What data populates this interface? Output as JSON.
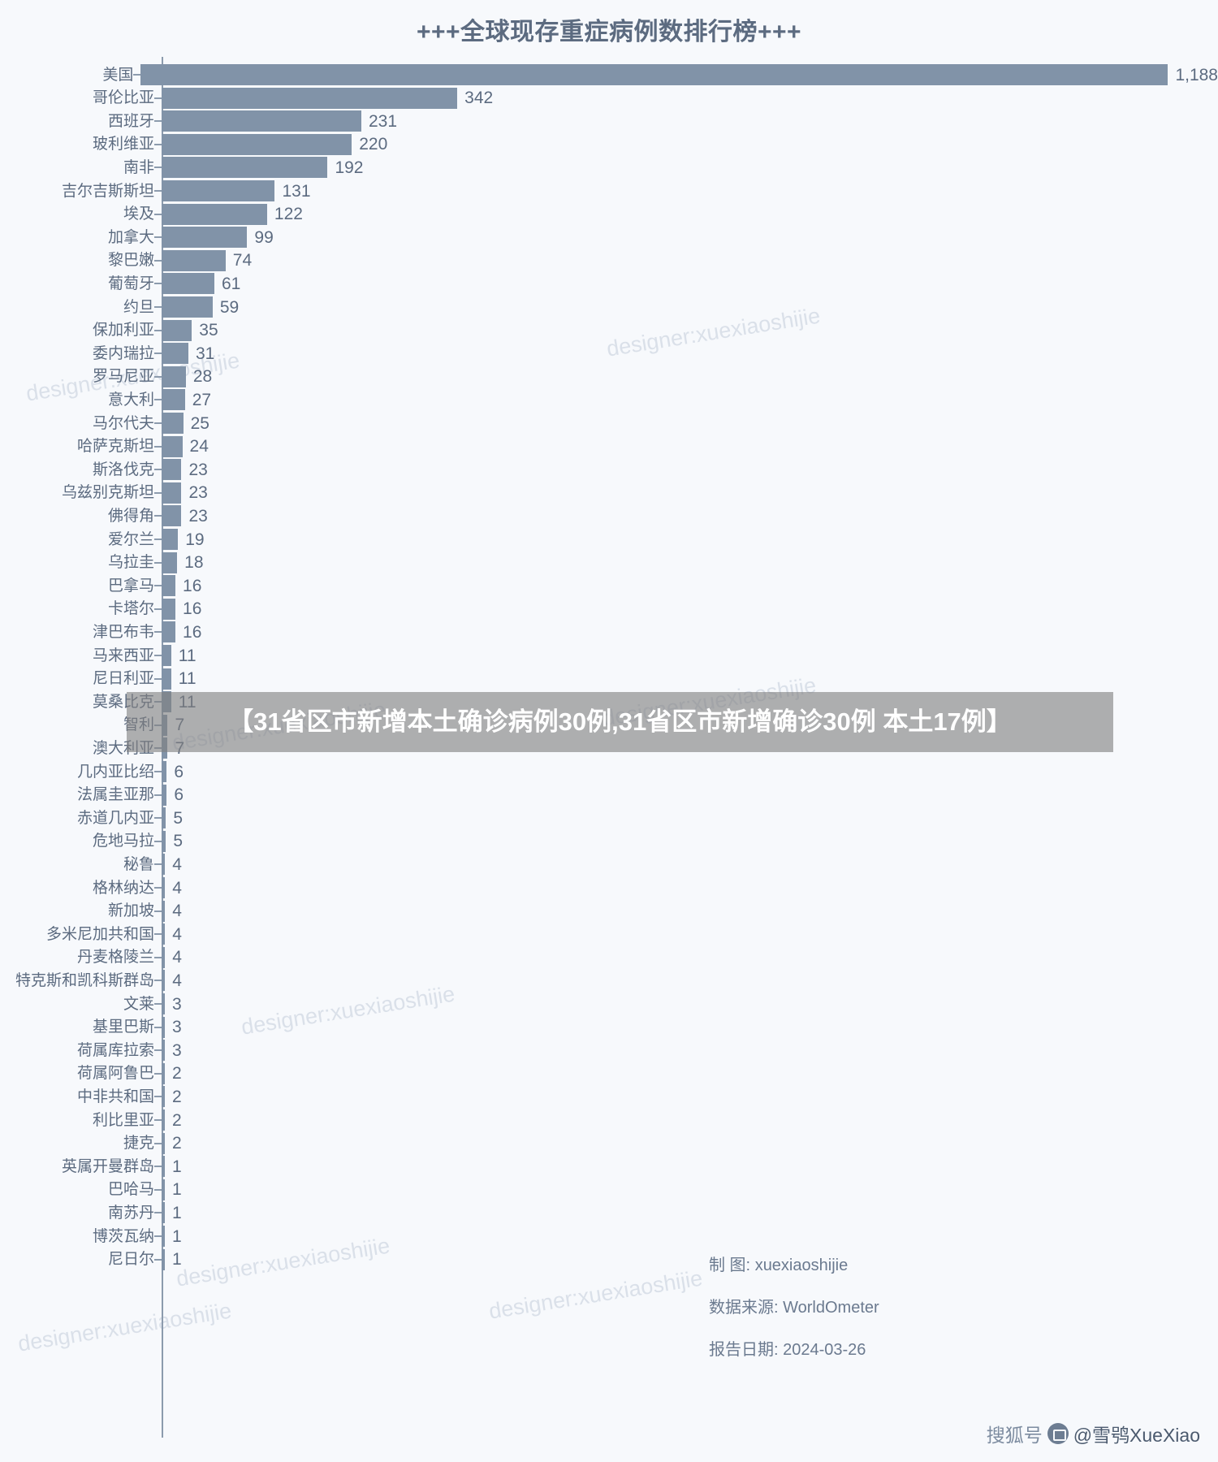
{
  "header": {
    "title": "+++全球现存重症病例数排行榜+++"
  },
  "overlay": {
    "text": "【31省区市新增本土确诊病例30例,31省区市新增确诊30例 本土17例】"
  },
  "watermarks": [
    "designer:xuexiaoshijie",
    "designer:xuexiaoshijie",
    "designer:xuexiaoshijie",
    "designer:xuexiaoshijie",
    "designer:xuexiaoshijie",
    "designer:xuexiaoshijie",
    "designer:xuexiaoshijie",
    "designer:xuexiaoshijie"
  ],
  "credits": [
    {
      "key": "制      图:",
      "value": "xuexiaoshijie"
    },
    {
      "key": "数据来源:",
      "value": "WorldOmeter"
    },
    {
      "key": "报告日期:",
      "value": "2024-03-26"
    }
  ],
  "badge": {
    "platform": "搜狐号",
    "account": "@雪鸮XueXiao",
    "icon": "sohu-logo-icon"
  },
  "colors": {
    "background": "#f7f9fc",
    "bar": "#8193a8",
    "text": "#5c6b80",
    "axis": "#8c9bad",
    "watermark": "#c9d2de",
    "overlay_bg": "rgba(128,128,128,0.62)",
    "overlay_text": "#ffffff"
  },
  "chart_data": {
    "type": "bar",
    "orientation": "horizontal",
    "title": "+++全球现存重症病例数排行榜+++",
    "xlabel": "",
    "ylabel": "",
    "grid": false,
    "legend": null,
    "xlim": [
      0,
      1188
    ],
    "value_labels": true,
    "source": "WorldOmeter",
    "report_date": "2024-03-26",
    "categories": [
      "美国",
      "哥伦比亚",
      "西班牙",
      "玻利维亚",
      "南非",
      "吉尔吉斯斯坦",
      "埃及",
      "加拿大",
      "黎巴嫩",
      "葡萄牙",
      "约旦",
      "保加利亚",
      "委内瑞拉",
      "罗马尼亚",
      "意大利",
      "马尔代夫",
      "哈萨克斯坦",
      "斯洛伐克",
      "乌兹别克斯坦",
      "佛得角",
      "爱尔兰",
      "乌拉圭",
      "巴拿马",
      "卡塔尔",
      "津巴布韦",
      "马来西亚",
      "尼日利亚",
      "莫桑比克",
      "智利",
      "澳大利亚",
      "几内亚比绍",
      "法属圭亚那",
      "赤道几内亚",
      "危地马拉",
      "秘鲁",
      "格林纳达",
      "新加坡",
      "多米尼加共和国",
      "丹麦格陵兰",
      "特克斯和凯科斯群岛",
      "文莱",
      "基里巴斯",
      "荷属库拉索",
      "荷属阿鲁巴",
      "中非共和国",
      "利比里亚",
      "捷克",
      "英属开曼群岛",
      "巴哈马",
      "南苏丹",
      "博茨瓦纳",
      "尼日尔"
    ],
    "values": [
      1188,
      342,
      231,
      220,
      192,
      131,
      122,
      99,
      74,
      61,
      59,
      35,
      31,
      28,
      27,
      25,
      24,
      23,
      23,
      23,
      19,
      18,
      16,
      16,
      16,
      11,
      11,
      11,
      7,
      7,
      6,
      6,
      5,
      5,
      4,
      4,
      4,
      4,
      4,
      4,
      3,
      3,
      3,
      2,
      2,
      2,
      2,
      1,
      1,
      1,
      1,
      1
    ],
    "value_label_texts": [
      "1,188",
      "342",
      "231",
      "220",
      "192",
      "131",
      "122",
      "99",
      "74",
      "61",
      "59",
      "35",
      "31",
      "28",
      "27",
      "25",
      "24",
      "23",
      "23",
      "23",
      "19",
      "18",
      "16",
      "16",
      "16",
      "11",
      "11",
      "11",
      "7",
      "7",
      "6",
      "6",
      "5",
      "5",
      "4",
      "4",
      "4",
      "4",
      "4",
      "4",
      "3",
      "3",
      "3",
      "2",
      "2",
      "2",
      "2",
      "1",
      "1",
      "1",
      "1",
      "1"
    ]
  }
}
